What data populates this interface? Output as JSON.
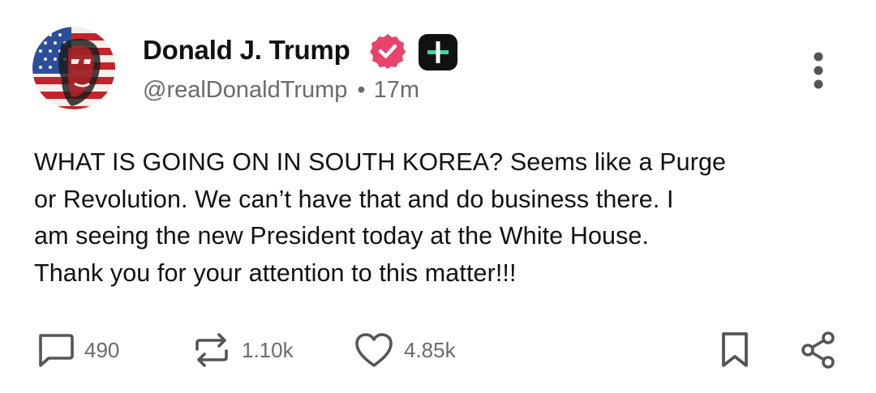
{
  "author": {
    "display_name": "Donald J. Trump",
    "handle": "@realDonaldTrump",
    "separator": "•",
    "timestamp": "17m",
    "avatar_icon": "flag-portrait-avatar",
    "verified_icon": "verified-badge-icon",
    "verified_color": "#e8436b",
    "plus_badge_icon": "plus-badge-icon",
    "plus_badge_color": "#111111",
    "plus_badge_accent": "#3fd6a8"
  },
  "post": {
    "text": "WHAT IS GOING ON IN SOUTH KOREA? Seems like a Purge\nor Revolution. We can’t have that and do business there. I\nam seeing the new President today at the White House.\nThank you for your attention to this matter!!!"
  },
  "menu": {
    "icon": "more-vertical-icon"
  },
  "actions": {
    "reply": {
      "icon": "reply-icon",
      "count": "490"
    },
    "repost": {
      "icon": "repost-icon",
      "count": "1.10k"
    },
    "like": {
      "icon": "heart-icon",
      "count": "4.85k"
    },
    "bookmark": {
      "icon": "bookmark-icon"
    },
    "share": {
      "icon": "share-icon"
    }
  },
  "colors": {
    "text": "#111111",
    "muted": "#6b6b6b",
    "icon": "#555555"
  }
}
